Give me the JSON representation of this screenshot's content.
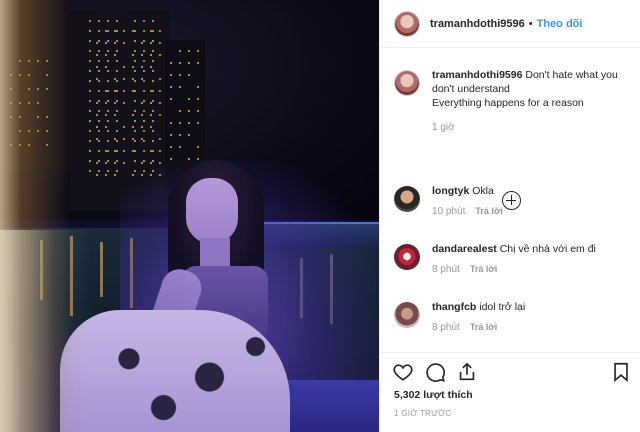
{
  "post": {
    "username": "tramanhdothi9596",
    "dot": "•",
    "follow_label": "Theo dõi"
  },
  "caption": {
    "username": "tramanhdothi9596",
    "lines": [
      "Don't hate what you don't understand",
      "Everything happens for a reason"
    ],
    "time": "1 giờ"
  },
  "comments": [
    {
      "username": "longtyk",
      "text": "Okla",
      "time": "10 phút",
      "reply_label": "Trả lời"
    },
    {
      "username": "dandarealest",
      "text": "Chị về nhà với em đi",
      "time": "8 phút",
      "reply_label": "Trả lời"
    },
    {
      "username": "thangfcb",
      "text": "idol trở lại",
      "time": "8 phút",
      "reply_label": "Trả lời"
    }
  ],
  "actions": {
    "icons": [
      "heart-icon",
      "comment-icon",
      "share-icon",
      "bookmark-icon"
    ],
    "likes": "5,302 lượt thích",
    "timestamp": "1 GIỜ TRƯỚC"
  },
  "colors": {
    "link_blue": "#3897f0",
    "text": "#262626",
    "muted": "#999999",
    "divider": "#efefef"
  }
}
